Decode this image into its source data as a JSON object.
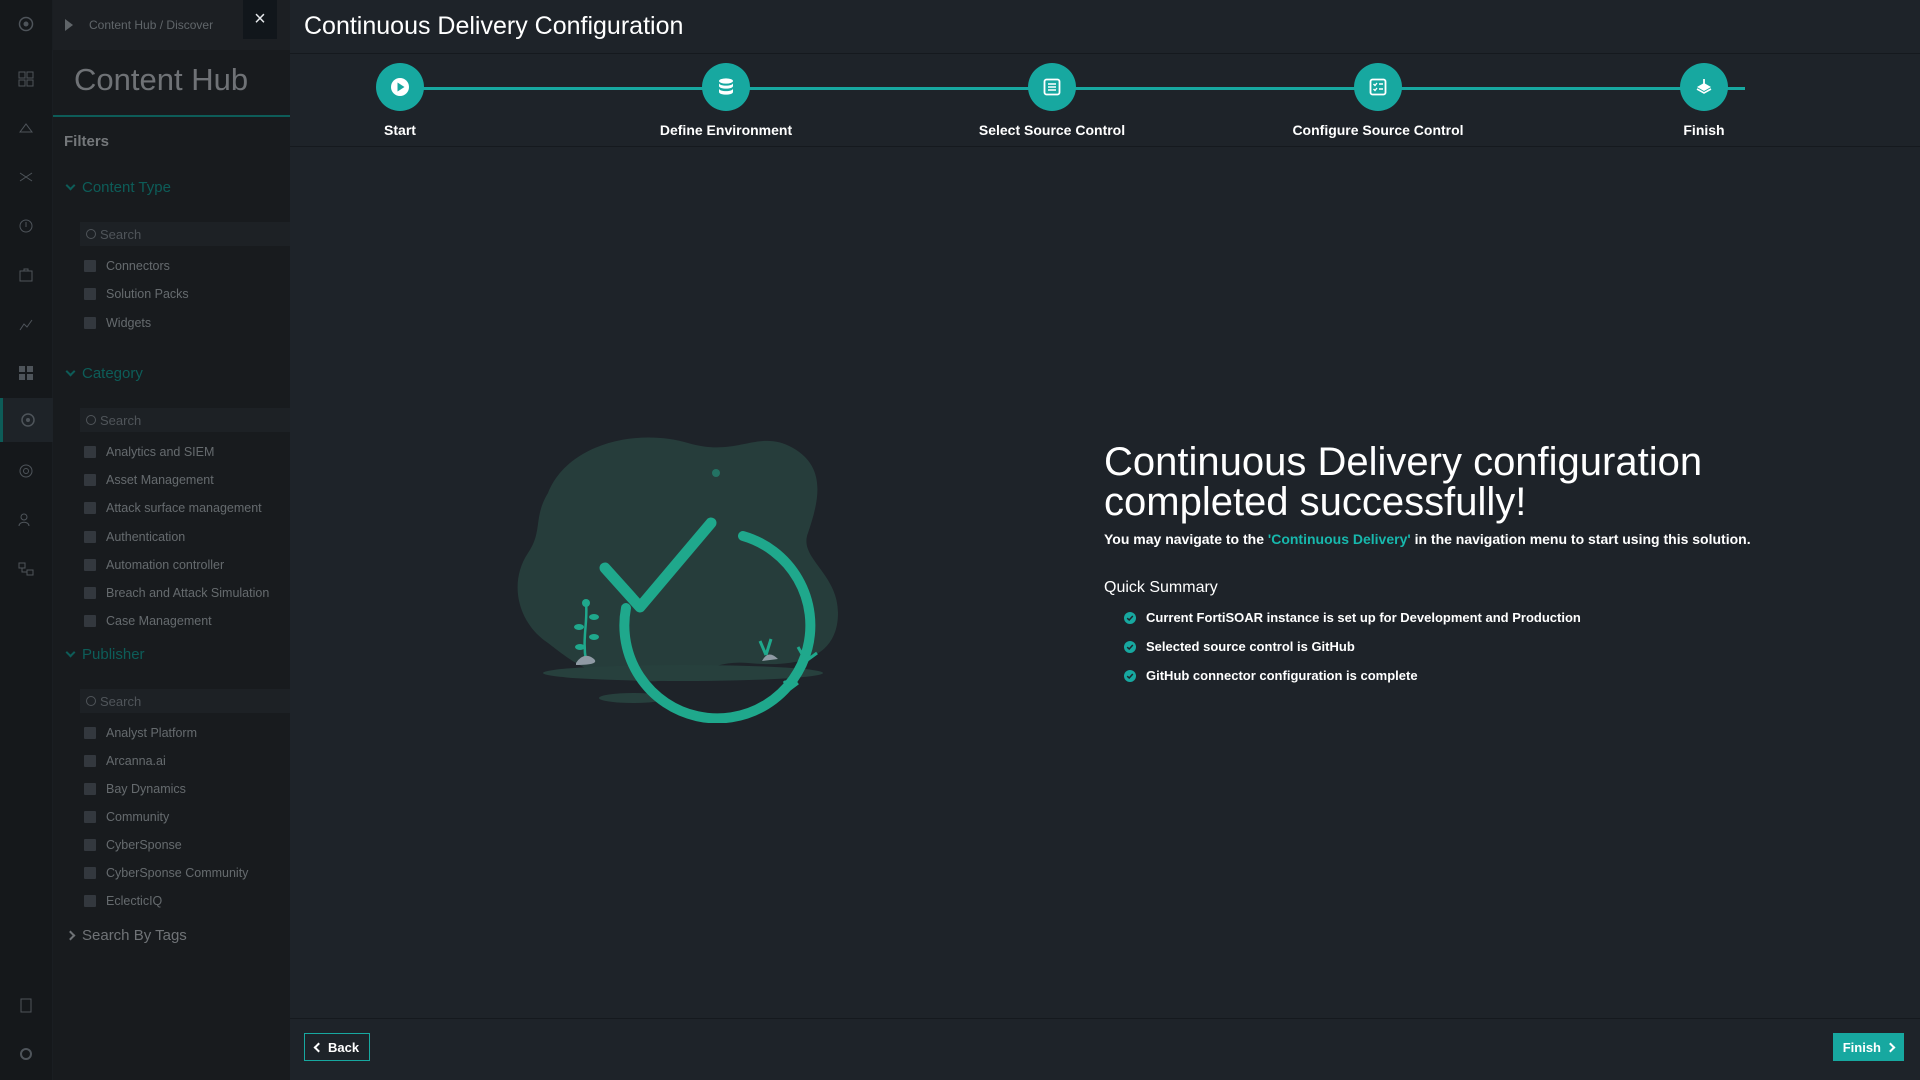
{
  "background": {
    "breadcrumb": [
      "Content Hub",
      "/",
      "Discover"
    ],
    "hub_title": "Content Hub",
    "filters_label": "Filters",
    "content_type": {
      "title": "Content Type",
      "search_placeholder": "Search",
      "items": [
        "Connectors",
        "Solution Packs",
        "Widgets"
      ]
    },
    "category": {
      "title": "Category",
      "search_placeholder": "Search",
      "items": [
        "Analytics and SIEM",
        "Asset Management",
        "Attack surface management",
        "Authentication",
        "Automation controller",
        "Breach and Attack Simulation",
        "Case Management"
      ]
    },
    "publisher": {
      "title": "Publisher",
      "search_placeholder": "Search",
      "items": [
        "Analyst Platform",
        "Arcanna.ai",
        "Bay Dynamics",
        "Community",
        "CyberSponse",
        "CyberSponse Community",
        "EclecticIQ"
      ]
    },
    "search_by_tags": "Search By Tags",
    "rail_icons": [
      "logo-icon",
      "dashboard-icon",
      "incidents-icon",
      "shuffle-icon",
      "alerts-icon",
      "cases-icon",
      "reports-icon",
      "apps-icon",
      "content-hub-icon",
      "settings-gear-icon",
      "users-icon",
      "playbooks-icon",
      "clipboard-icon",
      "settings-icon"
    ]
  },
  "close_glyph": "×",
  "wizard": {
    "title": "Continuous Delivery Configuration",
    "steps": [
      {
        "label": "Start",
        "icon": "play-icon"
      },
      {
        "label": "Define Environment",
        "icon": "database-icon"
      },
      {
        "label": "Select Source Control",
        "icon": "list-icon"
      },
      {
        "label": "Configure Source Control",
        "icon": "checklist-icon"
      },
      {
        "label": "Finish",
        "icon": "finish-icon"
      }
    ],
    "headline": "Continuous Delivery configuration completed successfully!",
    "sub_prefix": "You may navigate to the ",
    "sub_link": "'Continuous Delivery'",
    "sub_suffix": " in the navigation menu to start using this solution.",
    "summary_title": "Quick Summary",
    "summary_items": [
      "Current FortiSOAR instance is set up for Development and Production",
      "Selected source control is GitHub",
      "GitHub connector configuration is complete"
    ],
    "back_label": "Back",
    "finish_label": "Finish",
    "accent_color": "#17a8a0"
  }
}
